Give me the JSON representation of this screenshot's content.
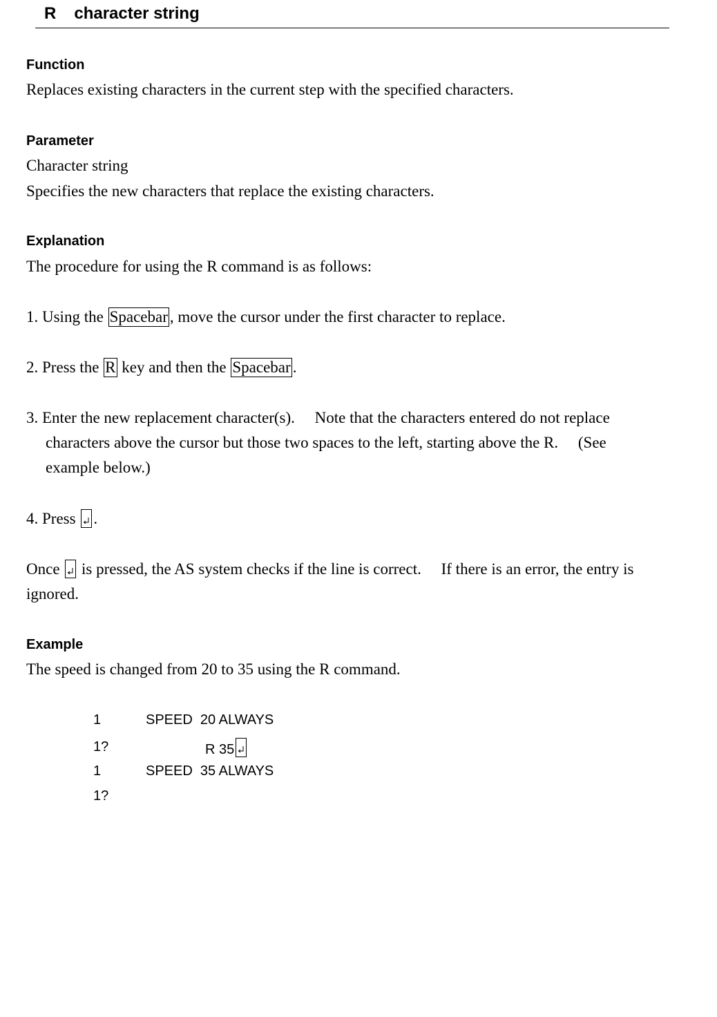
{
  "header": {
    "command": "R",
    "title": "character string"
  },
  "sections": {
    "function": {
      "heading": "Function",
      "text": "Replaces existing characters in the current step with the specified characters."
    },
    "parameter": {
      "heading": "Parameter",
      "name": "Character string",
      "text": "Specifies the new characters that replace the existing characters."
    },
    "explanation": {
      "heading": "Explanation",
      "intro": "The procedure for using the R command is as follows:",
      "step1": {
        "prefix": "1. Using the ",
        "key": "Spacebar",
        "suffix": ", move the cursor under the first character to replace."
      },
      "step2": {
        "prefix": "2. Press the ",
        "key1": "R",
        "middle": " key and then the ",
        "key2": "Spacebar",
        "suffix": "."
      },
      "step3": {
        "line1": "3. Enter the new replacement character(s).  Note that the characters entered do not replace",
        "line2": "characters above the cursor but those two spaces to the left, starting above the R.  (See",
        "line3": "example below.)"
      },
      "step4": {
        "prefix": "4. Press ",
        "suffix": "."
      },
      "note": {
        "prefix": "Once ",
        "line1_suffix": " is pressed, the AS system checks if the line is correct.  If there is an error, the entry is",
        "line2": "ignored."
      },
      "enter_key_icon": "enter-key-icon"
    },
    "example": {
      "heading": "Example",
      "text": "The speed is changed from 20 to 35 using the R command.",
      "lines": [
        {
          "num": "1",
          "content": "SPEED  20 ALWAYS"
        },
        {
          "num": "1?",
          "content": "R 35"
        },
        {
          "num": "1",
          "content": "SPEED  35 ALWAYS"
        },
        {
          "num": "1?",
          "content": ""
        }
      ]
    }
  }
}
